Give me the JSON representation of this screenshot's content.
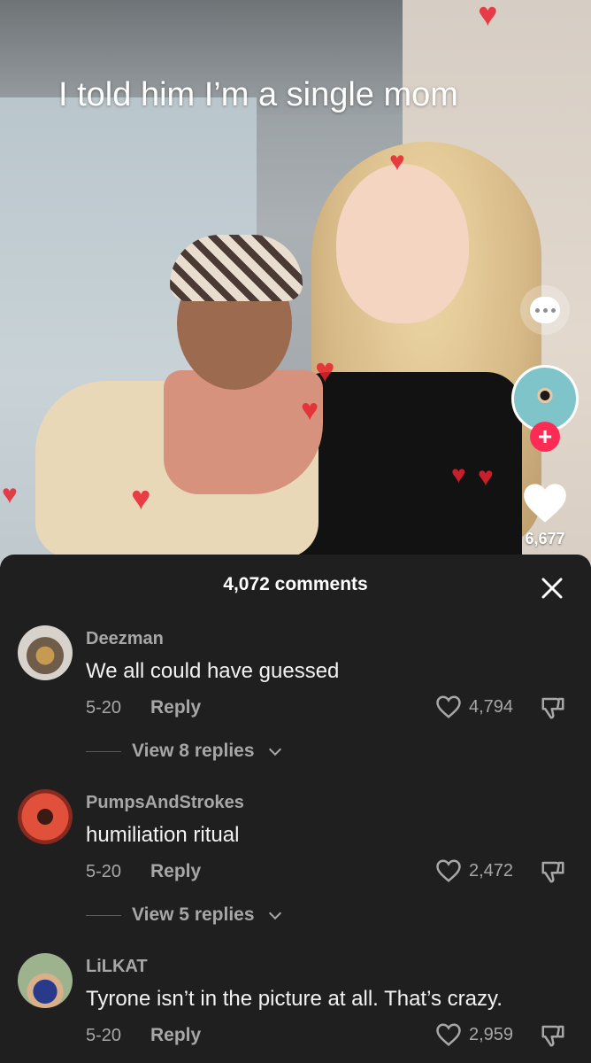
{
  "video": {
    "caption": "I told him I’m a single mom",
    "like_count": "6,677",
    "icons": [
      "comment-bubble-icon",
      "creator-avatar",
      "follow-plus-icon",
      "heart-icon"
    ]
  },
  "comments_sheet": {
    "title": "4,072 comments",
    "close_icon": "close-icon",
    "comments": [
      {
        "username": "Deezman",
        "text": "We all could have guessed",
        "date": "5-20",
        "reply_label": "Reply",
        "likes": "4,794",
        "view_replies": "View 8 replies"
      },
      {
        "username": "PumpsAndStrokes",
        "text": "humiliation ritual",
        "date": "5-20",
        "reply_label": "Reply",
        "likes": "2,472",
        "view_replies": "View 5 replies"
      },
      {
        "username": "LiLKAT",
        "text": "Tyrone isn’t in the picture at all. That’s crazy.",
        "date": "5-20",
        "reply_label": "Reply",
        "likes": "2,959"
      }
    ]
  },
  "colors": {
    "accent_red": "#fe2c55",
    "sheet_bg": "#1f1f1f",
    "muted_text": "#a7a7a7"
  }
}
